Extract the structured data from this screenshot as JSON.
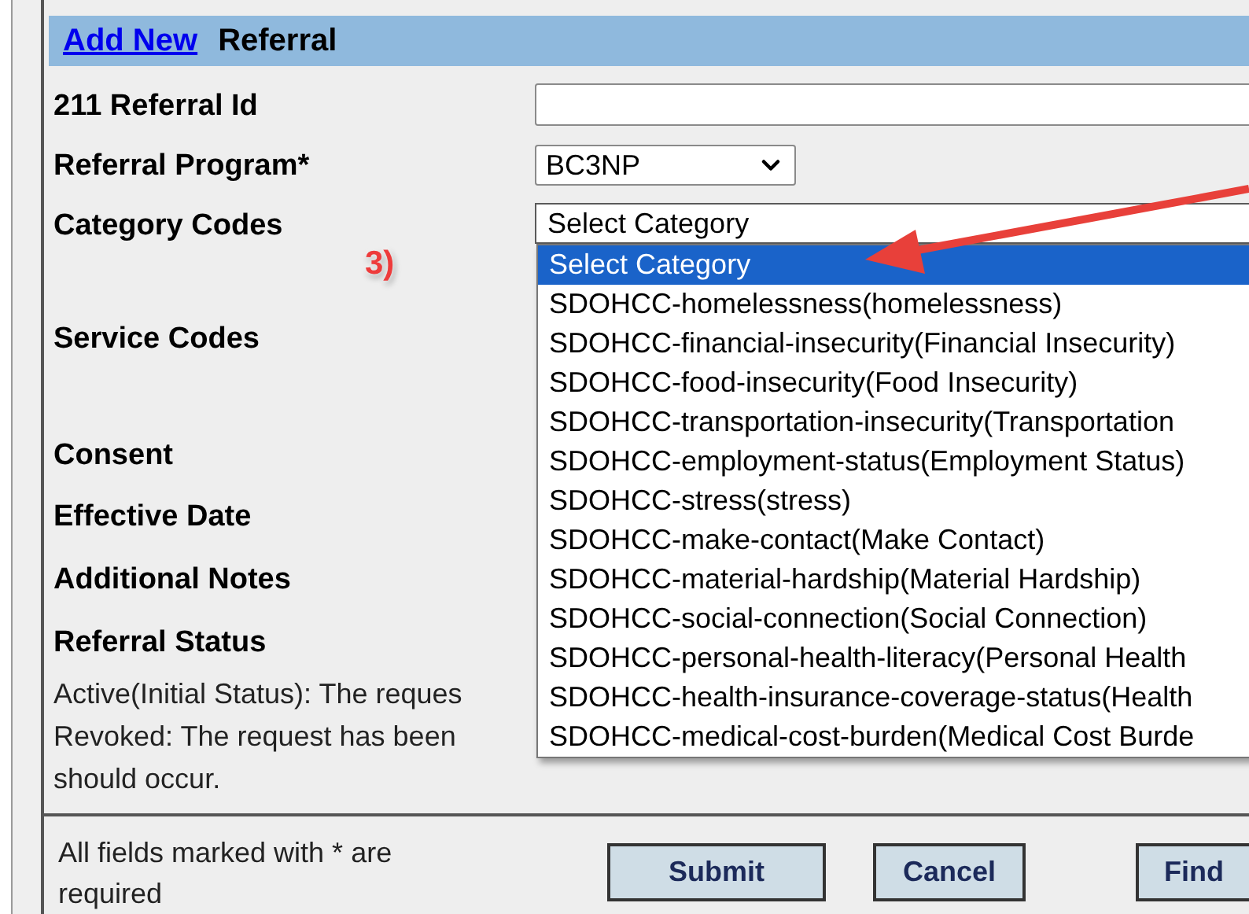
{
  "header": {
    "link": "Add New",
    "title": "Referral"
  },
  "fields": [
    {
      "label": "211 Referral Id",
      "kind": "text"
    },
    {
      "label": "Referral Program*",
      "kind": "select",
      "value": "BC3NP"
    },
    {
      "label": "Category Codes",
      "kind": "dropdown",
      "value": "Select Category",
      "open": true
    },
    {
      "label": "Service Codes",
      "kind": "plain"
    },
    {
      "label": "Consent",
      "kind": "plain"
    },
    {
      "label": "Effective Date",
      "kind": "plain"
    },
    {
      "label": "Additional Notes",
      "kind": "plain"
    },
    {
      "label": "Referral Status",
      "kind": "plain"
    }
  ],
  "options": [
    {
      "label": "Select Category",
      "selected": true
    },
    {
      "label": "SDOHCC-homelessness(homelessness)",
      "selected": false
    },
    {
      "label": "SDOHCC-financial-insecurity(Financial Insecurity)",
      "selected": false
    },
    {
      "label": "SDOHCC-food-insecurity(Food Insecurity)",
      "selected": false
    },
    {
      "label": "SDOHCC-transportation-insecurity(Transportation",
      "selected": false
    },
    {
      "label": "SDOHCC-employment-status(Employment Status)",
      "selected": false
    },
    {
      "label": "SDOHCC-stress(stress)",
      "selected": false
    },
    {
      "label": "SDOHCC-make-contact(Make Contact)",
      "selected": false
    },
    {
      "label": "SDOHCC-material-hardship(Material Hardship)",
      "selected": false
    },
    {
      "label": "SDOHCC-social-connection(Social Connection)",
      "selected": false
    },
    {
      "label": "SDOHCC-personal-health-literacy(Personal Health",
      "selected": false
    },
    {
      "label": "SDOHCC-health-insurance-coverage-status(Health",
      "selected": false
    },
    {
      "label": "SDOHCC-medical-cost-burden(Medical Cost Burde",
      "selected": false
    }
  ],
  "status_notes": [
    "Active(Initial Status): The reques",
    "Revoked: The request has been",
    "should occur."
  ],
  "annotation": {
    "step": "3)"
  },
  "footer": {
    "note": "All fields marked with * are required",
    "buttons": [
      "Submit",
      "Cancel",
      "Find"
    ]
  }
}
